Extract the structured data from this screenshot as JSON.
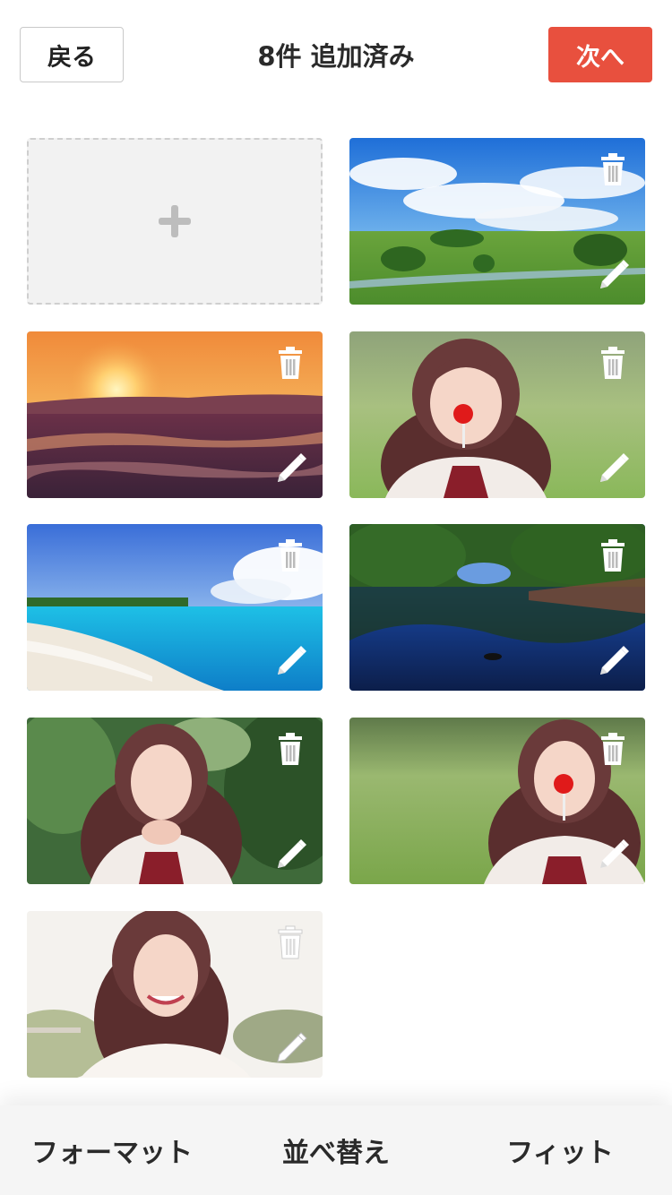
{
  "header": {
    "back_label": "戻る",
    "title": "8件 追加済み",
    "next_label": "次へ"
  },
  "colors": {
    "accent": "#e8503e"
  },
  "grid": {
    "add_icon": "plus-icon",
    "photos": [
      {
        "subject": "landscape-meadow",
        "delete_icon": "trash-icon",
        "edit_icon": "pencil-icon"
      },
      {
        "subject": "sunset-sea",
        "delete_icon": "trash-icon",
        "edit_icon": "pencil-icon"
      },
      {
        "subject": "girl-lollipop",
        "delete_icon": "trash-icon",
        "edit_icon": "pencil-icon"
      },
      {
        "subject": "beach",
        "delete_icon": "trash-icon",
        "edit_icon": "pencil-icon"
      },
      {
        "subject": "pond-reflection",
        "delete_icon": "trash-icon",
        "edit_icon": "pencil-icon"
      },
      {
        "subject": "girl-trees",
        "delete_icon": "trash-icon",
        "edit_icon": "pencil-icon"
      },
      {
        "subject": "girl-grass-lollipop",
        "delete_icon": "trash-icon",
        "edit_icon": "pencil-icon"
      },
      {
        "subject": "girl-smiling",
        "delete_icon": "trash-icon",
        "edit_icon": "pencil-icon"
      }
    ]
  },
  "toolbar": {
    "format_label": "フォーマット",
    "sort_label": "並べ替え",
    "fit_label": "フィット"
  }
}
